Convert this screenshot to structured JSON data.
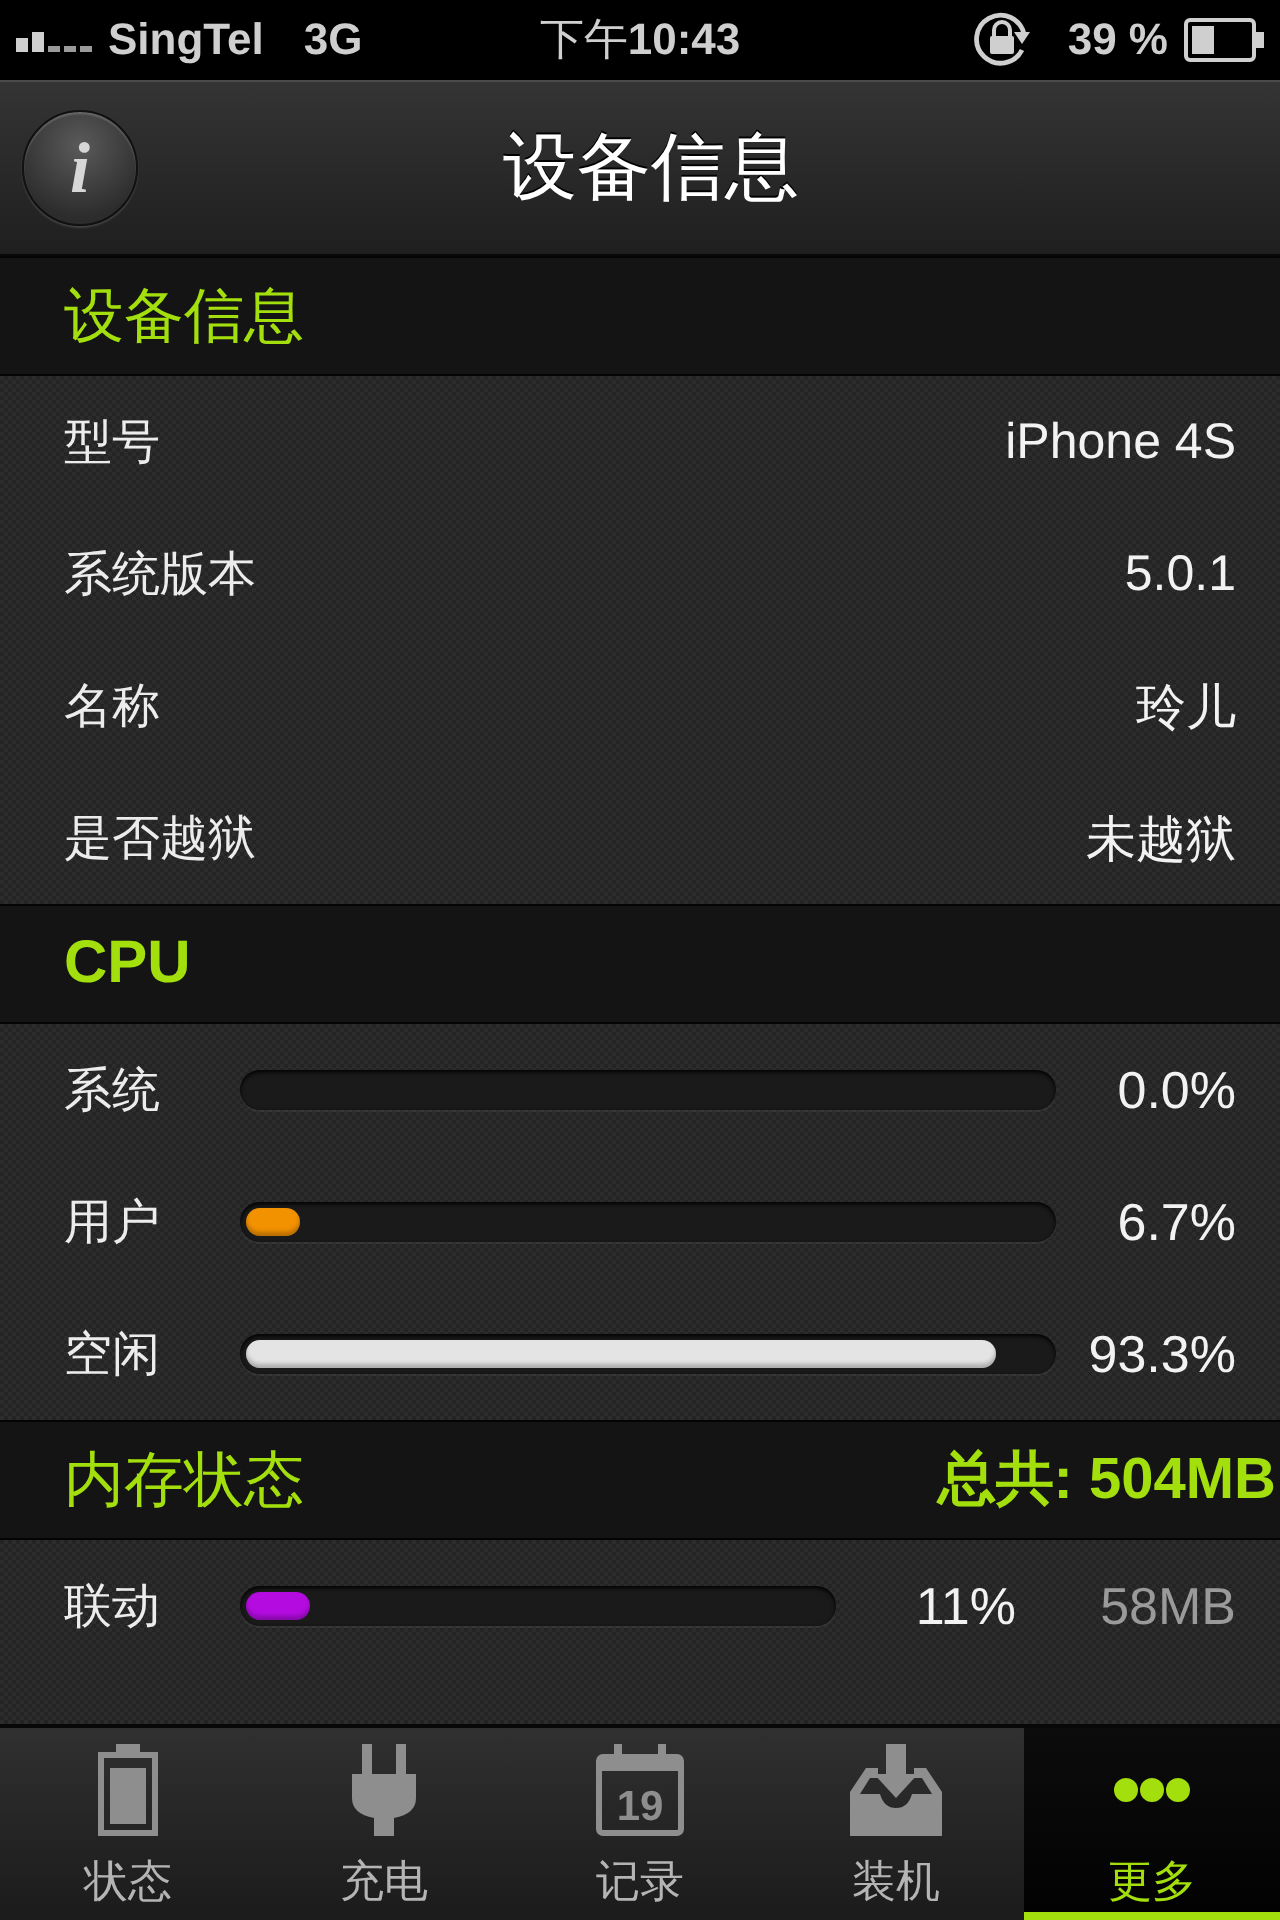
{
  "status_bar": {
    "carrier": "SingTel",
    "network": "3G",
    "time": "下午**10:43**",
    "battery": "39 %"
  },
  "nav_bar": {
    "info_button": "i",
    "title": "设备信息"
  },
  "device_info": {
    "title": "设备信息",
    "rows": [
      {
        "label": "型号",
        "value": "iPhone 4S"
      },
      {
        "label": "系统版本",
        "value": "5.0.1"
      },
      {
        "label": "名称",
        "value": "玲儿"
      },
      {
        "label": "是否越狱",
        "value": "未越狱"
      }
    ]
  },
  "cpu": {
    "title": "CPU",
    "rows": [
      {
        "label": "系统",
        "reading": "0.0%"
      },
      {
        "label": "用户",
        "level": 0.067,
        "reading": "6.7%",
        "color": "#f39200"
      },
      {
        "label": "空闲",
        "level": 0.933,
        "reading": "93.3%",
        "color": "#e4e4e4"
      }
    ]
  },
  "memory": {
    "title": "内存状态",
    "total": "总共: 504MB",
    "rows": [
      {
        "label": "联动",
        "level": 0.11,
        "percent": "11%",
        "size": "58MB",
        "color": "#b40ce0"
      }
    ]
  },
  "tab_bar": {
    "tabs": [
      {
        "label": "状态",
        "selected": false
      },
      {
        "label": "充电",
        "selected": false
      },
      {
        "label": "记录",
        "icon_text": "19",
        "selected": false
      },
      {
        "label": "装机",
        "selected": false
      },
      {
        "label": "更多",
        "selected": true
      }
    ]
  }
}
